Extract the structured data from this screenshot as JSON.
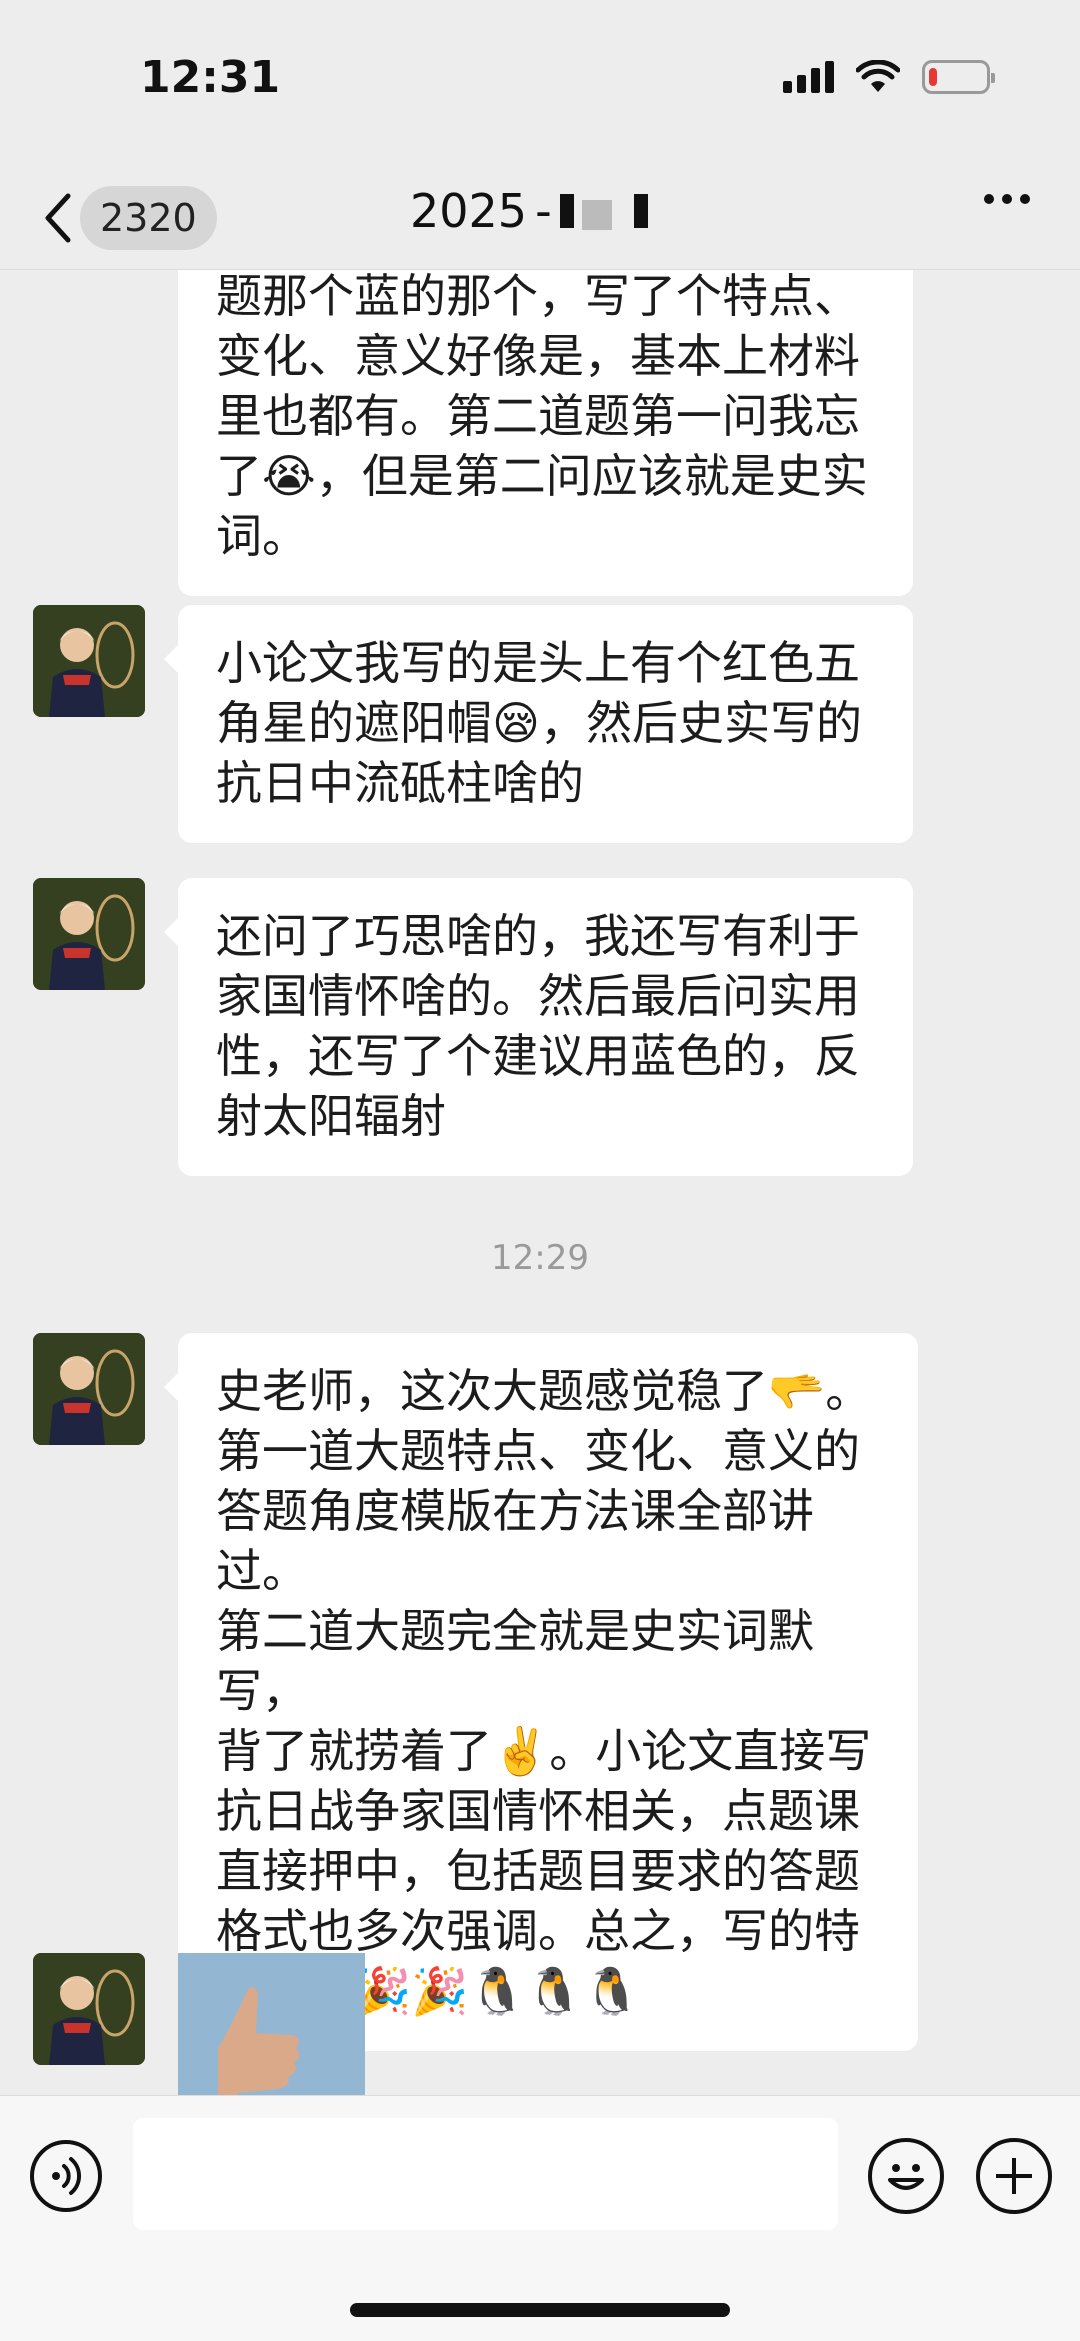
{
  "status_bar": {
    "time": "12:31",
    "battery_level": 0.15,
    "battery_color": "#e53935"
  },
  "nav": {
    "unread_count": "2320",
    "title": "2025",
    "title_suffix": "-"
  },
  "messages": [
    {
      "type": "text",
      "partial": true,
      "lines": [
        "题那个蓝的那个，写了个特点、",
        "变化、意义好像是，基本上材料",
        "里也都有。第二道题第一问我忘",
        "了😭，但是第二问应该就是史实",
        "词。"
      ]
    },
    {
      "type": "text",
      "lines": [
        "小论文我写的是头上有个红色五",
        "角星的遮阳帽😪，然后史实写的",
        "抗日中流砥柱啥的"
      ]
    },
    {
      "type": "text",
      "lines": [
        "还问了巧思啥的，我还写有利于",
        "家国情怀啥的。然后最后问实用",
        "性，还写了个建议用蓝色的，反",
        "射太阳辐射"
      ]
    },
    {
      "type": "timestamp",
      "text": "12:29"
    },
    {
      "type": "text",
      "lines": [
        "史老师，这次大题感觉稳了🫳。",
        "第一道大题特点、变化、意义的",
        "答题角度模版在方法课全部讲过。",
        "第二道大题完全就是史实词默写，",
        "背了就捞着了✌️。小论文直接写",
        "抗日战争家国情怀相关，点题课",
        "直接押中，包括题目要求的答题",
        "格式也多次强调。总之，写的特",
        "别顺畅🎉🎉🐧🐧🐧"
      ]
    },
    {
      "type": "image",
      "icon": "thumbs-up-photo"
    }
  ],
  "input": {
    "placeholder": ""
  },
  "colors": {
    "background": "#ededed",
    "bubble": "#ffffff",
    "input_bar": "#f7f7f7"
  }
}
